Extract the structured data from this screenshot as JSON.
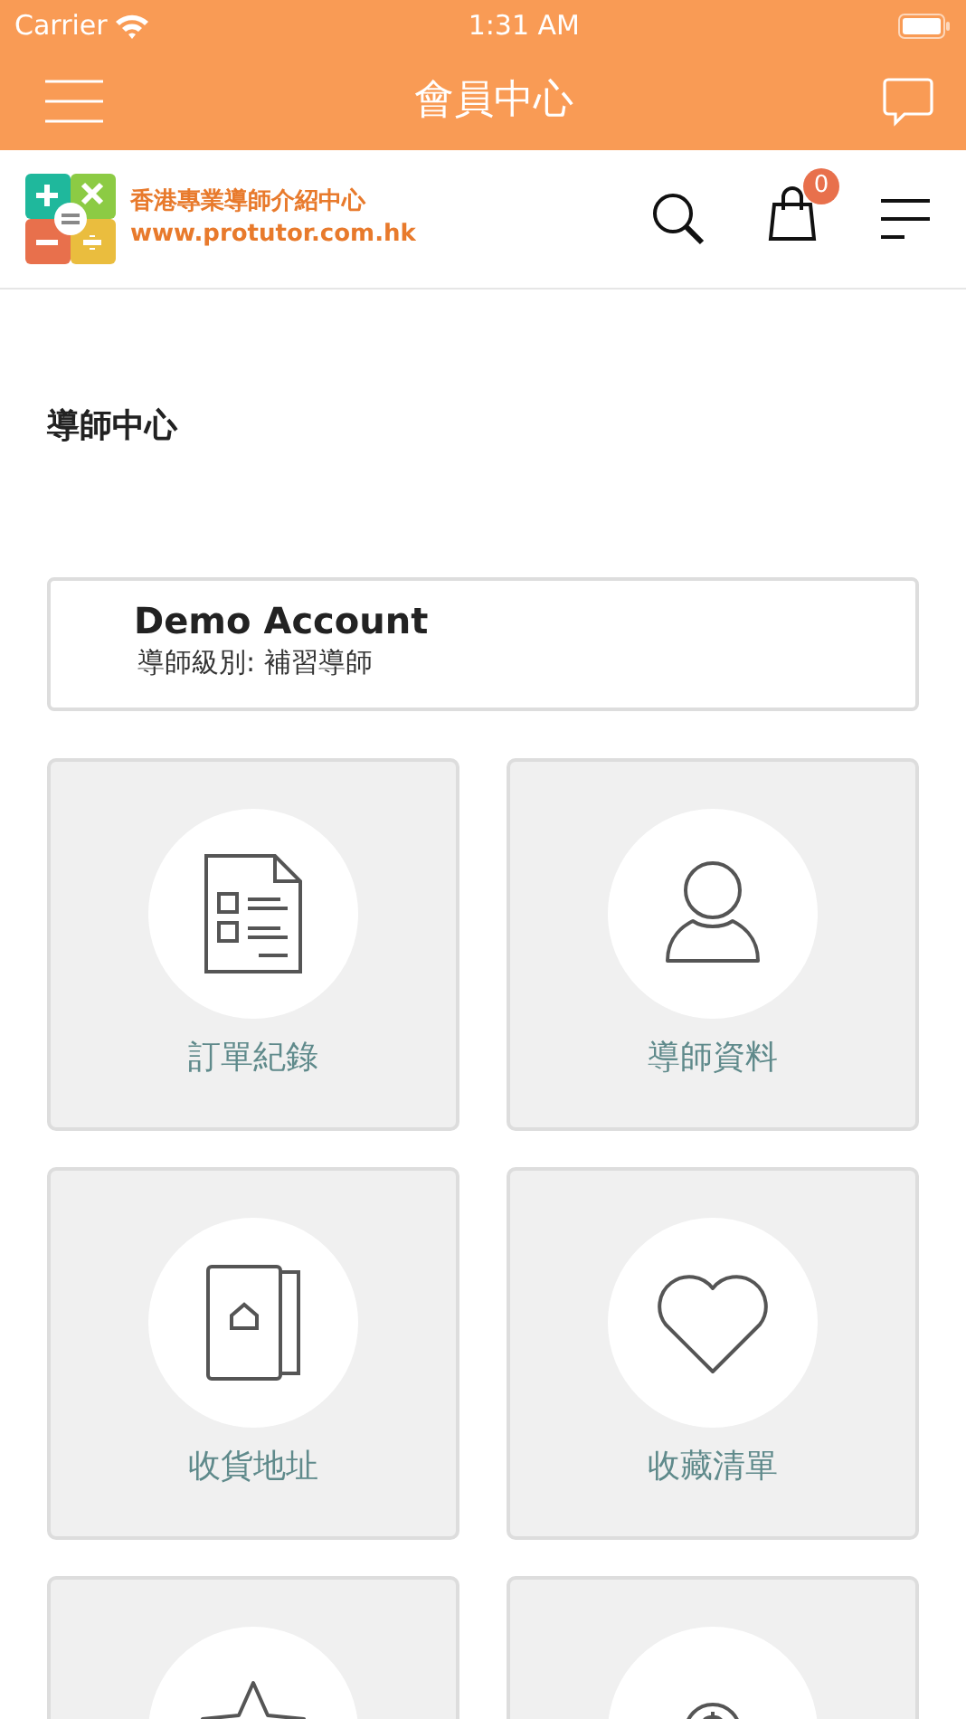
{
  "status_bar": {
    "carrier": "Carrier",
    "time": "1:31 AM"
  },
  "navbar": {
    "title": "會員中心"
  },
  "site_header": {
    "name": "香港專業導師介紹中心",
    "url": "www.protutor.com.hk",
    "cart_count": "0"
  },
  "page_title": "導師中心",
  "account": {
    "name": "Demo Account",
    "level": "導師級別: 補習導師"
  },
  "tiles": [
    {
      "kind": "orders",
      "label": "訂單紀錄"
    },
    {
      "kind": "profile",
      "label": "導師資料"
    },
    {
      "kind": "address",
      "label": "收貨地址"
    },
    {
      "kind": "wishlist",
      "label": "收藏清單"
    },
    {
      "kind": "star"
    },
    {
      "kind": "money"
    }
  ]
}
